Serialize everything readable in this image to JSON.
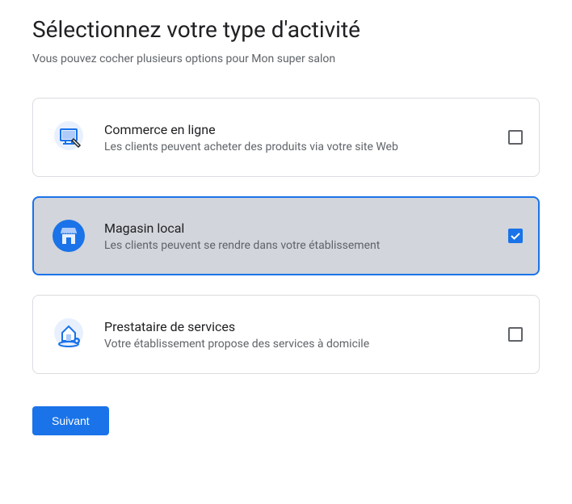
{
  "heading": "Sélectionnez votre type d'activité",
  "subtitle": "Vous pouvez cocher plusieurs options pour Mon super salon",
  "options": [
    {
      "title": "Commerce en ligne",
      "desc": "Les clients peuvent acheter des produits via votre site Web",
      "icon": "monitor-icon",
      "checked": false
    },
    {
      "title": "Magasin local",
      "desc": "Les clients peuvent se rendre dans votre établissement",
      "icon": "store-icon",
      "checked": true
    },
    {
      "title": "Prestataire de services",
      "desc": "Votre établissement propose des services à domicile",
      "icon": "home-pin-icon",
      "checked": false
    }
  ],
  "next_button": "Suivant"
}
